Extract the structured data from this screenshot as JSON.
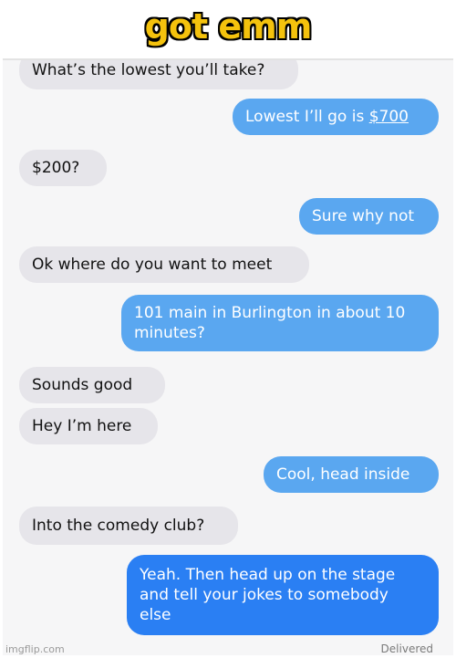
{
  "caption": "got emm",
  "messages": [
    {
      "side": "in",
      "text": "What’s the lowest you’ll take?"
    },
    {
      "side": "out",
      "text": "Lowest I’ll go is ",
      "link": "$700"
    },
    {
      "side": "in",
      "text": "$200?"
    },
    {
      "side": "out",
      "text": "Sure why not"
    },
    {
      "side": "in",
      "text": "Ok where do you want to meet"
    },
    {
      "side": "out",
      "text": "101 main in Burlington in about 10\nminutes?"
    },
    {
      "side": "in",
      "text": "Sounds good"
    },
    {
      "side": "in",
      "text": "Hey I’m here"
    },
    {
      "side": "out",
      "text": "Cool, head inside"
    },
    {
      "side": "in",
      "text": "Into the comedy club?"
    },
    {
      "side": "out",
      "text": "Yeah. Then head up on the stage\nand tell your jokes to somebody\nelse"
    }
  ],
  "status": "Delivered",
  "watermark": "imgflip.com",
  "colors": {
    "incoming": "#e6e5ea",
    "outgoing": "#5aa7f0",
    "outgoing_last": "#2a7ff3",
    "caption": "#f4c20d"
  }
}
